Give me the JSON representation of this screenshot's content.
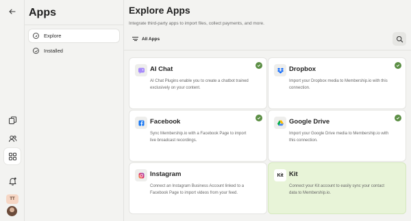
{
  "panel": {
    "title": "Apps",
    "nav": [
      {
        "label": "Explore"
      },
      {
        "label": "Installed"
      }
    ]
  },
  "rail": {
    "icons": [
      "back-arrow-icon",
      "copy-icon",
      "users-icon",
      "apps-grid-icon",
      "bell-icon"
    ],
    "avatar_initials": "TT"
  },
  "main": {
    "title": "Explore Apps",
    "subtitle": "Integrate third-party apps to import files, collect payments, and more.",
    "filter_label": "All Apps"
  },
  "cards": [
    {
      "title": "AI Chat",
      "description": "AI Chat Plugins enable you to create a chatbot trained exclusively on your content.",
      "installed": true
    },
    {
      "title": "Dropbox",
      "description": "Import your Dropbox media to Membership.io with this connection.",
      "installed": true
    },
    {
      "title": "Facebook",
      "description": "Sync Membership.io with a Facebook Page to import live broadcast recordings.",
      "installed": true
    },
    {
      "title": "Google Drive",
      "description": "Import your Google Drive media to Membership.io with this connection.",
      "installed": true
    },
    {
      "title": "Instagram",
      "description": "Connect an Instagram Business Account linked to a Facebook Page to import videos from your feed.",
      "installed": false
    },
    {
      "title": "Kit",
      "description": "Connect your Kit account to easily sync your contact data to Membership.io.",
      "installed": false,
      "logo_text": "Kit"
    }
  ],
  "colors": {
    "accent_green": "#5c8f45",
    "highlight": "#e8f4d8"
  }
}
